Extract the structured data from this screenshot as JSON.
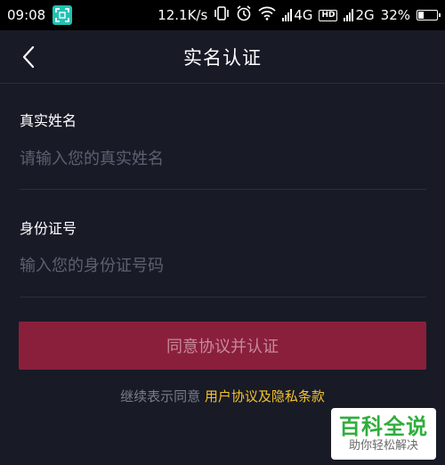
{
  "status_bar": {
    "time": "09:08",
    "network_speed": "12.1K/s",
    "network_4g": "4G",
    "hd_badge": "HD",
    "network_2g": "2G",
    "battery_percent": "32%",
    "battery_level": 0.32
  },
  "header": {
    "title": "实名认证"
  },
  "form": {
    "name_label": "真实姓名",
    "name_placeholder": "请输入您的真实姓名",
    "id_label": "身份证号",
    "id_placeholder": "输入您的身份证号码",
    "submit_label": "同意协议并认证"
  },
  "agreement": {
    "prefix": "继续表示同意",
    "link_text": "用户协议及隐私条款"
  },
  "watermark": {
    "title": "百科全说",
    "subtitle": "助你轻松解决"
  },
  "colors": {
    "background": "#181a26",
    "submit_bg": "#8a1f3c",
    "link": "#f4c22b",
    "watermark_green": "#2fae3c"
  }
}
